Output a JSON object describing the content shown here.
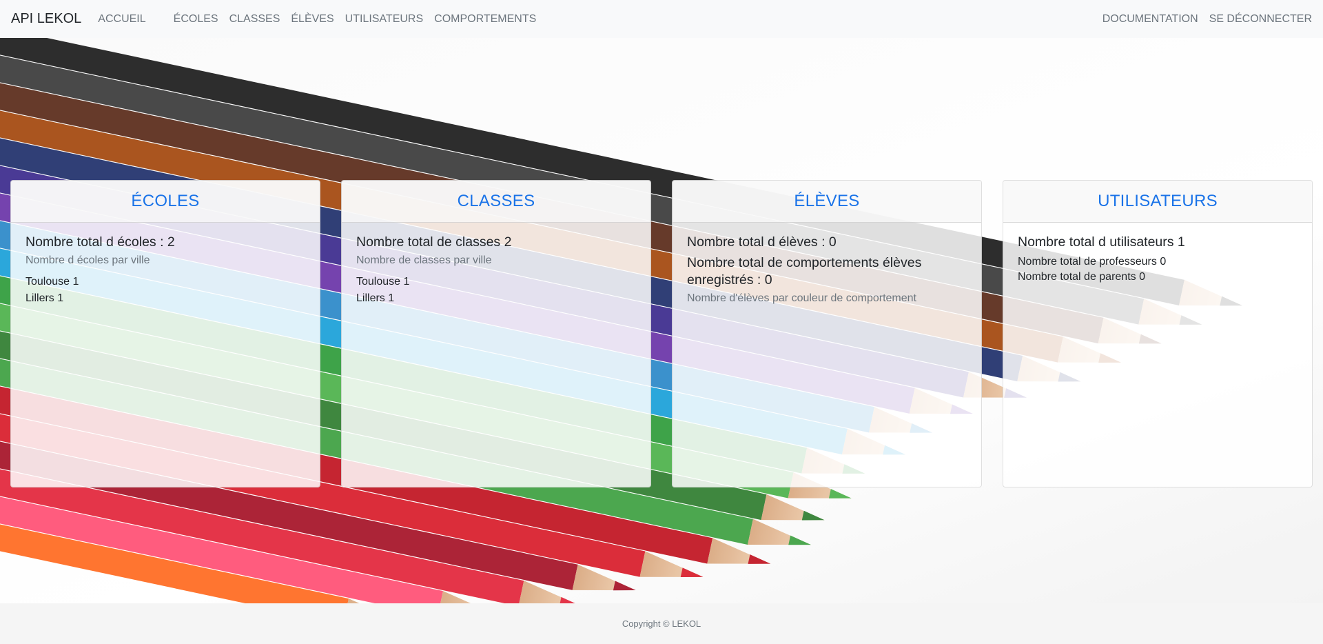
{
  "navbar": {
    "brand": "API LEKOL",
    "home": "ACCUEIL",
    "links": [
      "ÉCOLES",
      "CLASSES",
      "ÉLÈVES",
      "UTILISATEURS",
      "COMPORTEMENTS"
    ],
    "right": [
      "DOCUMENTATION",
      "SE DÉCONNECTER"
    ]
  },
  "cards": {
    "ecoles": {
      "header": "ÉCOLES",
      "title": "Nombre total d écoles : 2",
      "subtitle": "Nombre d écoles par ville",
      "items": [
        "Toulouse 1",
        "Lillers 1"
      ]
    },
    "classes": {
      "header": "CLASSES",
      "title": "Nombre total de classes 2",
      "subtitle": "Nombre de classes par ville",
      "items": [
        "Toulouse 1",
        "Lillers 1"
      ]
    },
    "eleves": {
      "header": "ÉLÈVES",
      "title": "Nombre total d élèves : 0",
      "title2": "Nombre total de comportements élèves enregistrés : 0",
      "subtitle": "Nombre d'élèves par couleur de comportement"
    },
    "utilisateurs": {
      "header": "UTILISATEURS",
      "title": "Nombre total d utilisateurs 1",
      "items": [
        "Nombre total de professeurs 0",
        "Nombre total de parents 0"
      ]
    }
  },
  "footer": {
    "copyright": "Copyright © LEKOL"
  },
  "colors": {
    "accent": "#1a73e8",
    "navbar_bg": "#f8f9fa",
    "footer_bg": "#f5f5f5"
  }
}
